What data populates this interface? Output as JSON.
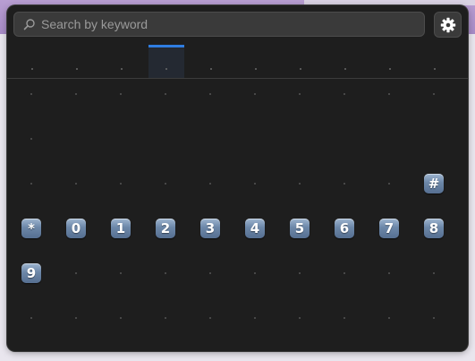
{
  "search": {
    "placeholder": "Search by keyword"
  },
  "icons": {
    "search": "magnifier-icon",
    "settings": "gear-icon"
  },
  "tabs": {
    "count": 10,
    "active_index": 3
  },
  "emoji_grid": {
    "columns": 10,
    "rows": [
      [
        null,
        null,
        null,
        null,
        null,
        null,
        null,
        null,
        null,
        null
      ],
      [
        null
      ],
      [
        null,
        null,
        null,
        null,
        null,
        null,
        null,
        null,
        null,
        "#"
      ],
      [
        "*",
        "0",
        "1",
        "2",
        "3",
        "4",
        "5",
        "6",
        "7",
        "8"
      ],
      [
        "9",
        null,
        null,
        null,
        null,
        null,
        null,
        null,
        null,
        null
      ],
      [
        null,
        null,
        null,
        null,
        null,
        null,
        null,
        null,
        null,
        null
      ]
    ]
  },
  "colors": {
    "accent": "#2f7de1",
    "panel_bg": "#1e1e1e",
    "keycap": "#6c87a8"
  }
}
